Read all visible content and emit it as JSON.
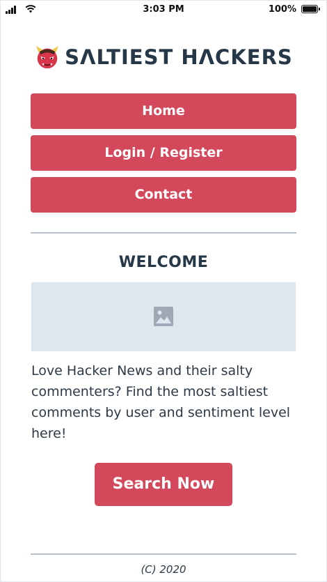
{
  "status_bar": {
    "time": "3:03 PM",
    "battery": "100%"
  },
  "header": {
    "title": "SΛLTIEST HΛCKERS",
    "logo_icon": "oni-demon-mask-icon"
  },
  "nav": {
    "items": [
      "Home",
      "Login / Register",
      "Contact"
    ]
  },
  "main": {
    "heading": "WELCOME",
    "image_icon": "image-placeholder-icon",
    "description": "Love Hacker News and their salty commenters? Find the most saltiest comments by user and sentiment level here!",
    "cta_label": "Search Now"
  },
  "footer": {
    "copyright": "(C) 2020"
  },
  "colors": {
    "accent": "#d4485c",
    "heading": "#263747",
    "text": "#2d3a45",
    "divider": "#b7c0c9",
    "placeholder_bg": "#dfe6ee"
  }
}
